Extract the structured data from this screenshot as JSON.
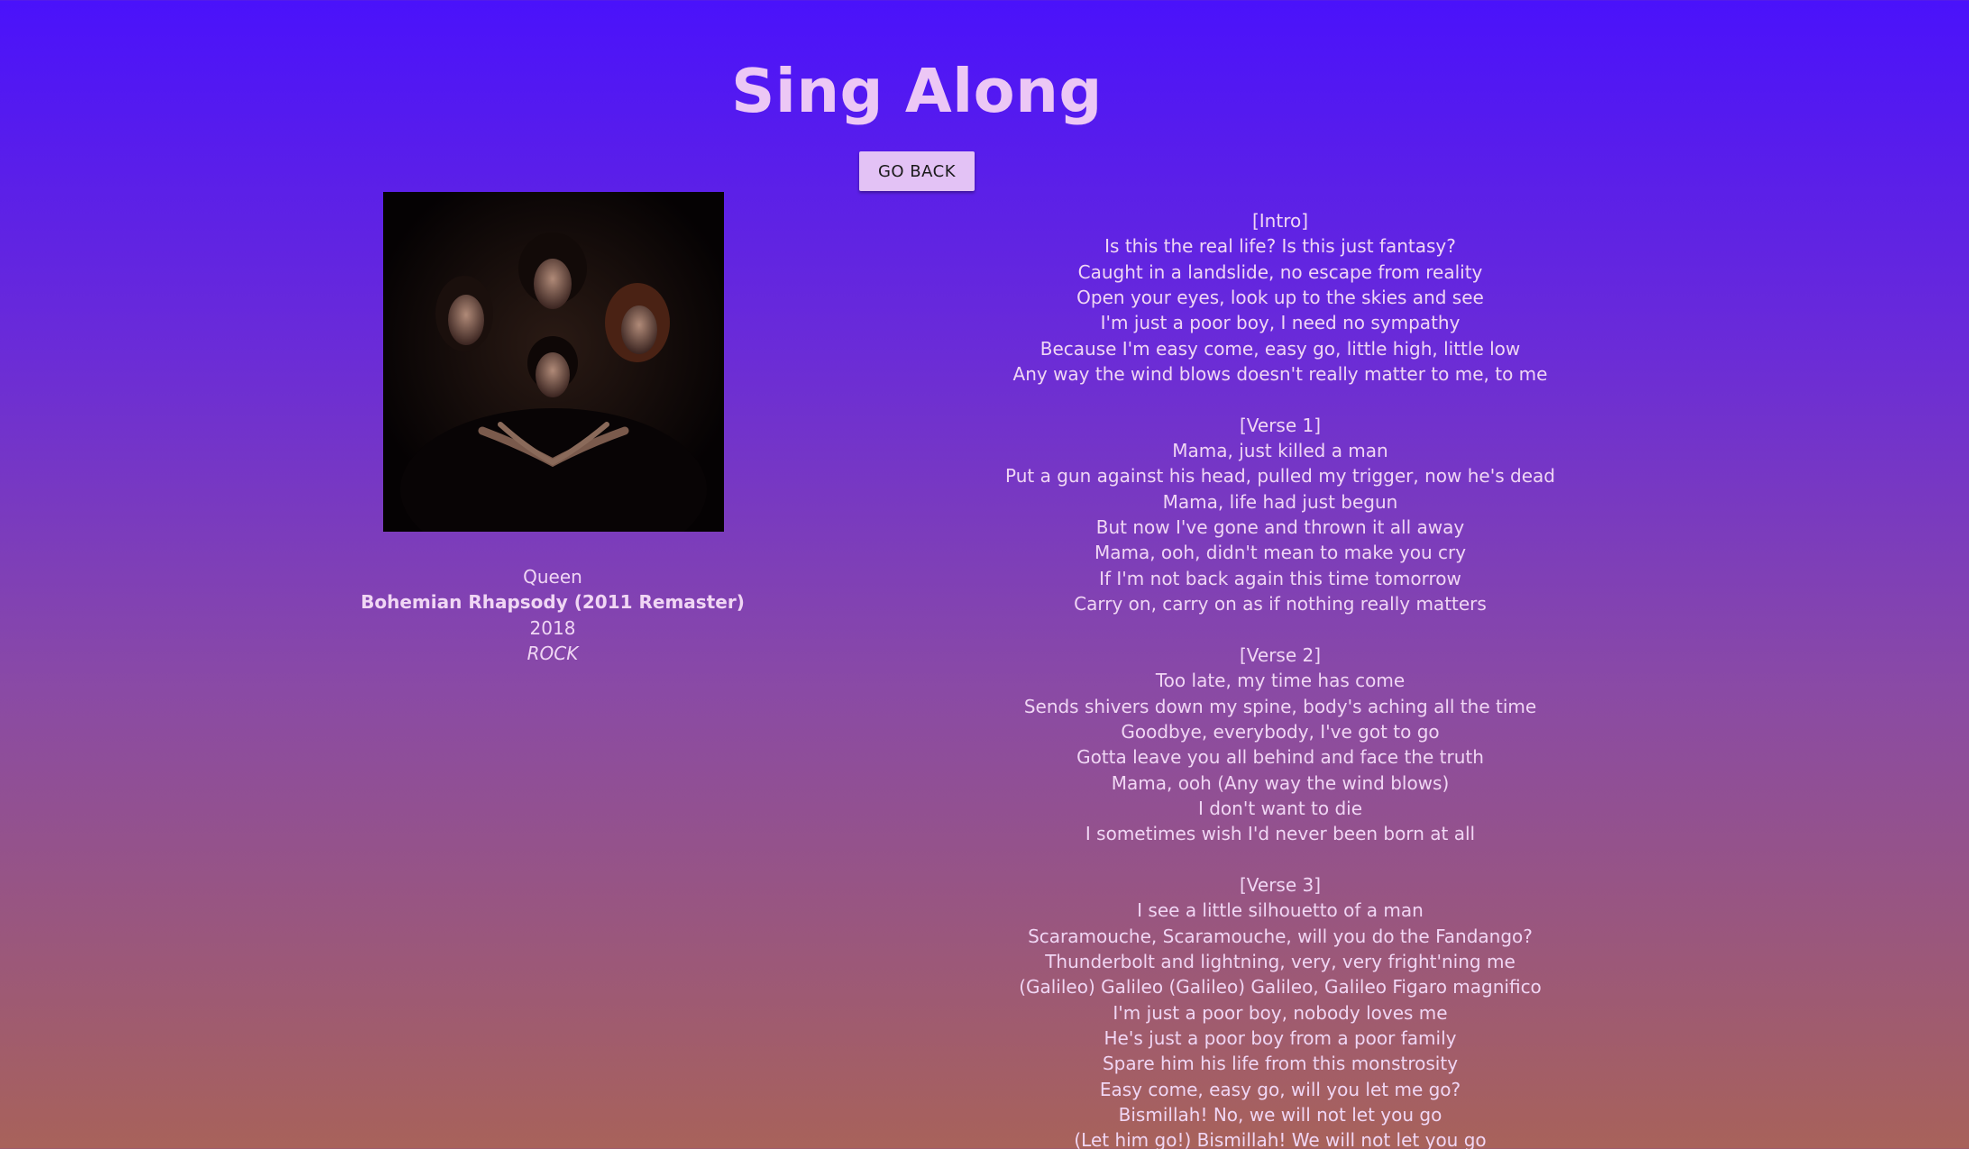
{
  "header": {
    "title": "Sing Along",
    "back_label": "GO BACK"
  },
  "song": {
    "artist": "Queen",
    "title": "Bohemian Rhapsody (2011 Remaster)",
    "year": "2018",
    "genre": "ROCK",
    "album_art": "band-portrait-image"
  },
  "lyrics": {
    "sections": [
      {
        "label": "[Intro]",
        "lines": [
          "Is this the real life? Is this just fantasy?",
          "Caught in a landslide, no escape from reality",
          "Open your eyes, look up to the skies and see",
          "I'm just a poor boy, I need no sympathy",
          "Because I'm easy come, easy go, little high, little low",
          "Any way the wind blows doesn't really matter to me, to me"
        ]
      },
      {
        "label": "[Verse 1]",
        "lines": [
          "Mama, just killed a man",
          "Put a gun against his head, pulled my trigger, now he's dead",
          "Mama, life had just begun",
          "But now I've gone and thrown it all away",
          "Mama, ooh, didn't mean to make you cry",
          "If I'm not back again this time tomorrow",
          "Carry on, carry on as if nothing really matters"
        ]
      },
      {
        "label": "[Verse 2]",
        "lines": [
          "Too late, my time has come",
          "Sends shivers down my spine, body's aching all the time",
          "Goodbye, everybody, I've got to go",
          "Gotta leave you all behind and face the truth",
          "Mama, ooh (Any way the wind blows)",
          "I don't want to die",
          "I sometimes wish I'd never been born at all"
        ]
      },
      {
        "label": "[Verse 3]",
        "lines": [
          "I see a little silhouetto of a man",
          "Scaramouche, Scaramouche, will you do the Fandango?",
          "Thunderbolt and lightning, very, very fright'ning me",
          "(Galileo) Galileo (Galileo) Galileo, Galileo Figaro magnifico",
          "I'm just a poor boy, nobody loves me",
          "He's just a poor boy from a poor family",
          "Spare him his life from this monstrosity",
          "Easy come, easy go, will you let me go?",
          "Bismillah! No, we will not let you go",
          "(Let him go!) Bismillah! We will not let you go"
        ]
      }
    ]
  }
}
